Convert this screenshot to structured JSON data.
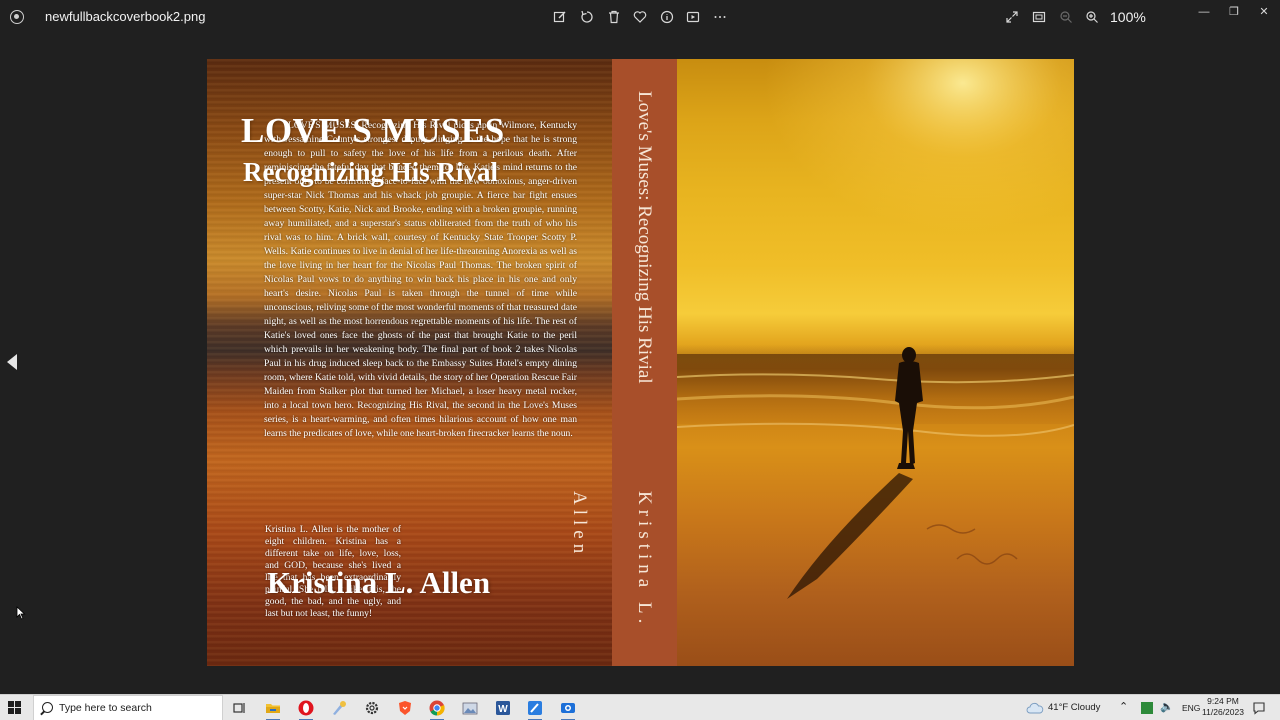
{
  "window": {
    "file_name": "newfullbackcoverbook2.png",
    "zoom": "100%",
    "toolbar_icons": [
      "edit-icon",
      "rotate-icon",
      "delete-icon",
      "favorite-icon",
      "info-icon",
      "slideshow-icon",
      "more-icon"
    ],
    "view_icons": [
      "fullscreen-icon",
      "fit-window-icon",
      "zoom-out-icon",
      "zoom-in-icon"
    ]
  },
  "cover": {
    "blurb": "LOVE'S MUSES, Recognizing His Rival picks up in Wilmore, Kentucky with Jessamine County's strongest deputy clinging to the hope that he is strong enough to pull to safety the love of his life from a perilous death. After reminiscing the fateful day that bonded them for life, Katie's mind returns to the present only to be confronted face-to-face with the new obnoxious, anger-driven super-star Nick Thomas and his whack job groupie. A fierce bar fight ensues between Scotty, Katie, Nick and Brooke, ending with a broken groupie, running away humiliated, and a superstar's status obliterated from the truth of who his rival was to him. A brick wall, courtesy of Kentucky State Trooper Scotty P. Wells. Katie continues to live in denial of her life-threatening Anorexia as well as the love living in her heart for the Nicolas Paul Thomas. The broken spirit of Nicolas Paul vows to do anything to win back his place in his one and only heart's desire. Nicolas Paul is taken through the tunnel of time while unconscious, reliving some of the most wonderful moments of that treasured date night, as well as the most horrendous regrettable moments of his life. The rest of Katie's loved ones face the ghosts of the past that brought Katie to the peril which prevails in her weakening body. The final part of book 2 takes Nicolas Paul in his drug induced sleep back to the Embassy Suites Hotel's empty dining room, where Katie told, with vivid details, the story of her Operation Rescue Fair Maiden from Stalker plot that turned her Michael, a loser heavy metal rocker, into a local town hero. Recognizing His Rival, the second in the Love's Muses series, is a heart-warming, and often times hilarious account of how one man learns the predicates of love, while one heart-broken firecracker learns the noun.",
    "bio": "Kristina L. Allen is the mother of eight children. Kristina has a different take on life, love, loss, and GOD, because she's lived a life that has been extraordinarily painful. She tells it like it is, the good, the bad, and the ugly, and last but not least, the funny!",
    "spine_title": "Love's Muses: Recognizing His Rivial",
    "spine_author": "Kristina L. Allen",
    "front_title": "LOVE'S MUSES",
    "front_subtitle": "Recognizing His Rival",
    "front_author": "Kristina L. Allen"
  },
  "taskbar": {
    "search_placeholder": "Type here to search",
    "apps": [
      "task-view-icon",
      "file-explorer-icon",
      "opera-icon",
      "paint-icon",
      "settings-icon",
      "brave-icon",
      "chrome-icon",
      "photos-viewer-icon",
      "word-icon",
      "paint-3d-icon",
      "camera-icon"
    ],
    "weather": "41°F  Cloudy",
    "language": "ENG",
    "time": "9:24 PM",
    "date": "11/26/2023"
  }
}
